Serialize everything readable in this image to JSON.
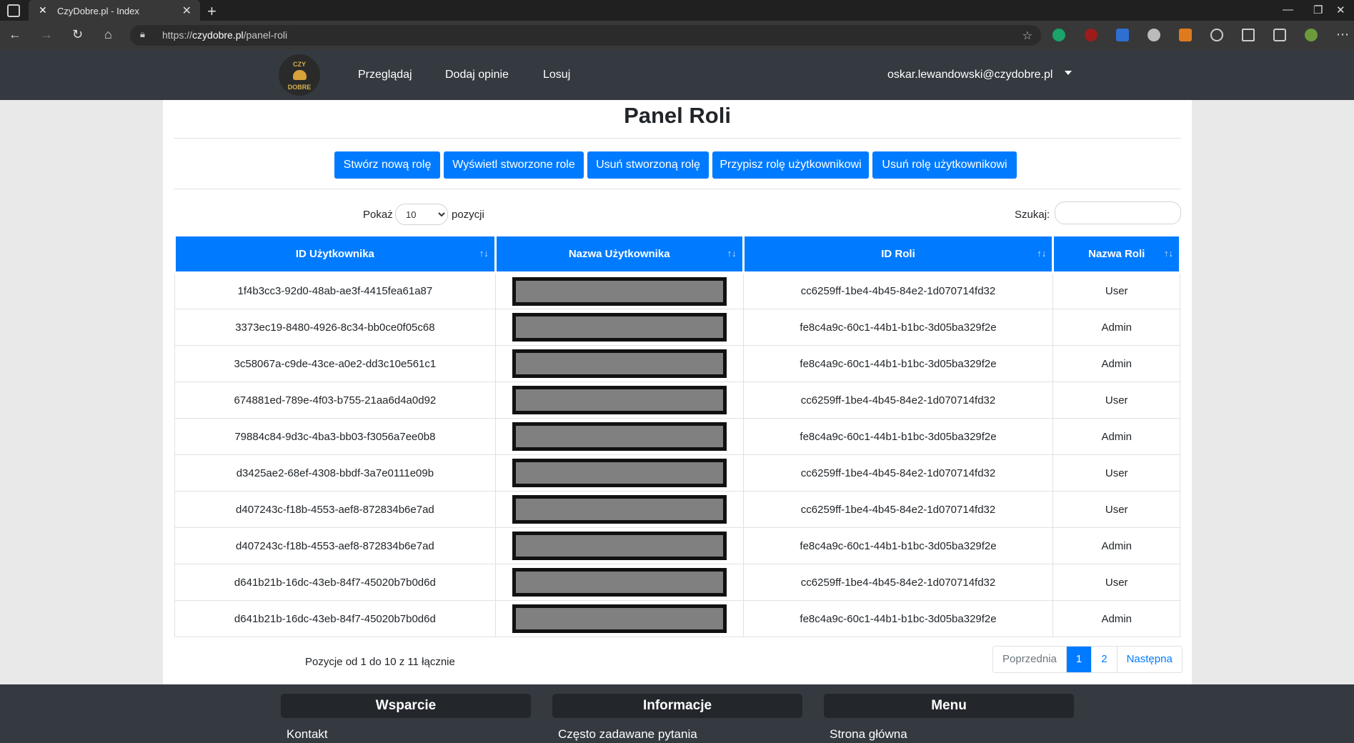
{
  "browser": {
    "tab_title": "CzyDobre.pl - Index",
    "url_prefix": "https://",
    "url_host": "czydobre.pl",
    "url_path": "/panel-roli"
  },
  "nav": {
    "logo_top": "CZY",
    "logo_bottom": "DOBRE",
    "links": [
      "Przeglądaj",
      "Dodaj opinie",
      "Losuj"
    ],
    "user_email": "oskar.lewandowski@czydobre.pl"
  },
  "page": {
    "title": "Panel Roli",
    "buttons": [
      "Stwórz nową rolę",
      "Wyświetl stworzone role",
      "Usuń stworzoną rolę",
      "Przypisz rolę użytkownikowi",
      "Usuń rolę użytkownikowi"
    ],
    "show_label": "Pokaż",
    "show_value": "10",
    "show_suffix": "pozycji",
    "search_label": "Szukaj:",
    "search_value": ""
  },
  "table": {
    "headers": [
      "ID Użytkownika",
      "Nazwa Użytkownika",
      "ID Roli",
      "Nazwa Roli"
    ],
    "rows": [
      {
        "user_id": "1f4b3cc3-92d0-48ab-ae3f-4415fea61a87",
        "role_id": "cc6259ff-1be4-4b45-84e2-1d070714fd32",
        "role_name": "User"
      },
      {
        "user_id": "3373ec19-8480-4926-8c34-bb0ce0f05c68",
        "role_id": "fe8c4a9c-60c1-44b1-b1bc-3d05ba329f2e",
        "role_name": "Admin"
      },
      {
        "user_id": "3c58067a-c9de-43ce-a0e2-dd3c10e561c1",
        "role_id": "fe8c4a9c-60c1-44b1-b1bc-3d05ba329f2e",
        "role_name": "Admin"
      },
      {
        "user_id": "674881ed-789e-4f03-b755-21aa6d4a0d92",
        "role_id": "cc6259ff-1be4-4b45-84e2-1d070714fd32",
        "role_name": "User"
      },
      {
        "user_id": "79884c84-9d3c-4ba3-bb03-f3056a7ee0b8",
        "role_id": "fe8c4a9c-60c1-44b1-b1bc-3d05ba329f2e",
        "role_name": "Admin"
      },
      {
        "user_id": "d3425ae2-68ef-4308-bbdf-3a7e0111e09b",
        "role_id": "cc6259ff-1be4-4b45-84e2-1d070714fd32",
        "role_name": "User"
      },
      {
        "user_id": "d407243c-f18b-4553-aef8-872834b6e7ad",
        "role_id": "cc6259ff-1be4-4b45-84e2-1d070714fd32",
        "role_name": "User"
      },
      {
        "user_id": "d407243c-f18b-4553-aef8-872834b6e7ad",
        "role_id": "fe8c4a9c-60c1-44b1-b1bc-3d05ba329f2e",
        "role_name": "Admin"
      },
      {
        "user_id": "d641b21b-16dc-43eb-84f7-45020b7b0d6d",
        "role_id": "cc6259ff-1be4-4b45-84e2-1d070714fd32",
        "role_name": "User"
      },
      {
        "user_id": "d641b21b-16dc-43eb-84f7-45020b7b0d6d",
        "role_id": "fe8c4a9c-60c1-44b1-b1bc-3d05ba329f2e",
        "role_name": "Admin"
      }
    ],
    "info": "Pozycje od 1 do 10 z 11 łącznie",
    "pager": {
      "prev": "Poprzednia",
      "pages": [
        "1",
        "2"
      ],
      "next": "Następna"
    }
  },
  "footer": {
    "headings": [
      "Wsparcie",
      "Informacje",
      "Menu"
    ],
    "links": [
      "Kontakt",
      "Często zadawane pytania",
      "Strona główna"
    ]
  },
  "colors": {
    "primary": "#007bff",
    "nav_bg": "#343a40",
    "redaction": "#808080"
  }
}
